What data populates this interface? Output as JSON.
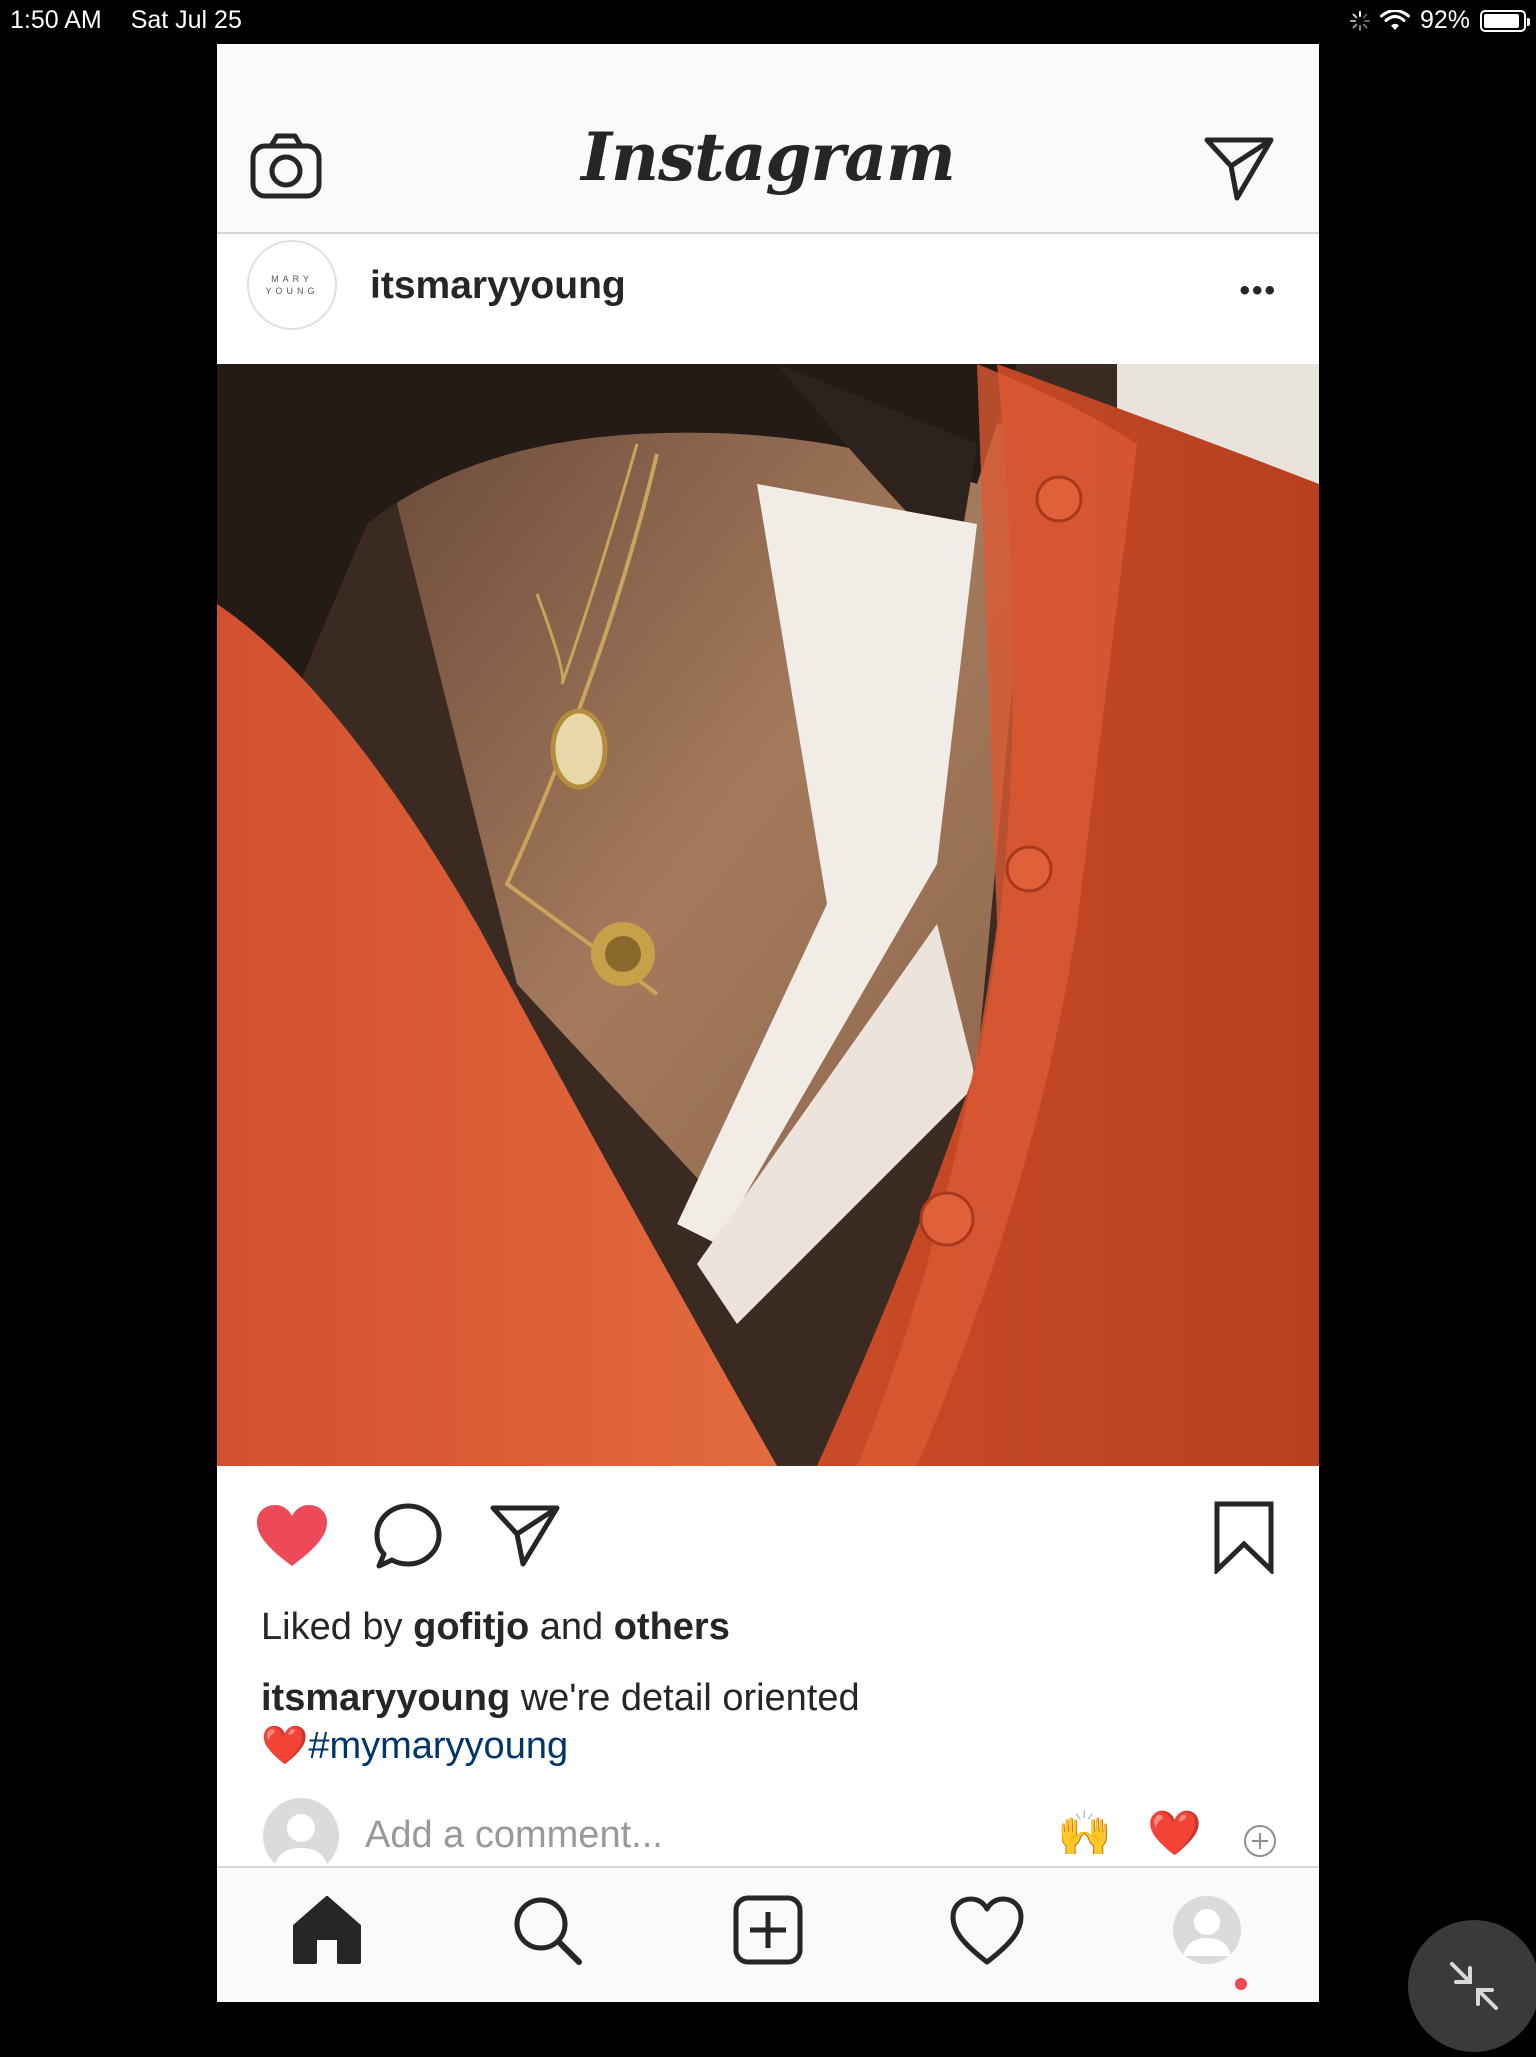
{
  "status_bar": {
    "time": "1:50 AM",
    "date": "Sat Jul 25",
    "battery": "92%",
    "battery_level": 0.92
  },
  "app": {
    "logo": "Instagram"
  },
  "post": {
    "username": "itsmaryyoung",
    "avatar_text_line1": "MARY",
    "avatar_text_line2": "YOUNG",
    "more_label": "•••",
    "liked_prefix": "Liked by",
    "liked_user": "gofitjo",
    "liked_and": "and",
    "liked_others": "others",
    "caption_user": "itsmaryyoung",
    "caption_text": "we're detail oriented",
    "caption_emoji": "❤️",
    "hashtag": "#mymaryyoung",
    "liked": true
  },
  "comment": {
    "placeholder": "Add a comment...",
    "quick_emoji_1": "🙌",
    "quick_emoji_2": "❤️"
  },
  "colors": {
    "like_red": "#ed4956",
    "hashtag_blue": "#003569",
    "icon_dark": "#262626"
  },
  "icons": [
    "camera-icon",
    "direct-icon",
    "more-icon",
    "heart-icon",
    "comment-icon",
    "share-icon",
    "bookmark-icon",
    "home-icon",
    "search-icon",
    "new-post-icon",
    "activity-icon",
    "profile-icon",
    "collapse-icon"
  ]
}
